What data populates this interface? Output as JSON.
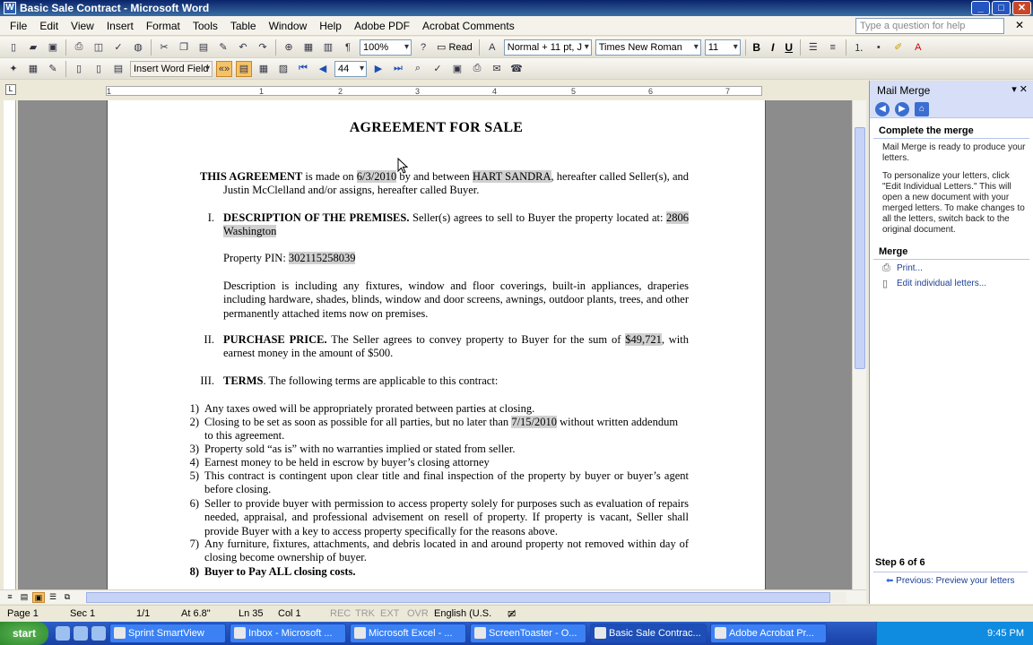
{
  "window": {
    "title": "Basic Sale Contract - Microsoft Word"
  },
  "menu": {
    "items": [
      "File",
      "Edit",
      "View",
      "Insert",
      "Format",
      "Tools",
      "Table",
      "Window",
      "Help",
      "Adobe PDF",
      "Acrobat Comments"
    ],
    "help_placeholder": "Type a question for help"
  },
  "toolbar": {
    "zoom": "100%",
    "read_label": "Read",
    "style": "Normal + 11 pt, J",
    "font": "Times New Roman",
    "size": "11"
  },
  "mailmerge_toolbar": {
    "insert_word_field": "Insert Word Field",
    "record": "44"
  },
  "document": {
    "title": "AGREEMENT FOR SALE",
    "intro_bold": "THIS AGREEMENT",
    "intro_text1": " is made on ",
    "date": "6/3/2010",
    "intro_text2": " by and between ",
    "seller": "HART SANDRA",
    "intro_text3": ", hereafter called Seller(s), and Justin McClelland and/or assigns, hereafter called Buyer.",
    "sec1_num": "I.",
    "sec1_head": "DESCRIPTION OF THE PREMISES.",
    "sec1_text": " Seller(s) agrees to sell to Buyer the property located at: ",
    "address": "2806 Washington",
    "pin_label": "Property PIN: ",
    "pin": "302115258039",
    "description": "Description is including any fixtures, window and floor coverings, built-in appliances, draperies including hardware, shades, blinds, window and door screens, awnings, outdoor plants, trees, and other permanently attached items now on premises.",
    "sec2_num": "II.",
    "sec2_head": "PURCHASE PRICE.",
    "sec2_text1": " The Seller agrees to convey property to Buyer for the sum of ",
    "price": "$49,721",
    "sec2_text2": ", with earnest money in the amount of $500.",
    "sec3_num": "III.",
    "sec3_head": "TERMS",
    "sec3_text": ". The following terms are applicable to this contract:",
    "terms": [
      {
        "num": "1)",
        "text": "Any taxes owed will be appropriately prorated between parties at closing."
      },
      {
        "num": "2)",
        "text_a": "Closing to be set as soon as possible for all parties, but no later than ",
        "date": "7/15/2010",
        "text_b": " without written addendum to this agreement."
      },
      {
        "num": "3)",
        "text": "Property sold “as is” with no warranties implied or stated from seller."
      },
      {
        "num": "4)",
        "text": "Earnest money to be held in escrow by buyer’s closing attorney"
      },
      {
        "num": "5)",
        "text": "This contract is contingent upon clear title and final inspection of the property by buyer or buyer’s agent before closing."
      },
      {
        "num": "6)",
        "text": "Seller to provide buyer with permission to access property solely for purposes such as evaluation of repairs needed, appraisal, and professional advisement on resell of property.  If property is vacant, Seller shall provide Buyer with a key to access property specifically for the reasons above."
      },
      {
        "num": "7)",
        "text": "Any furniture, fixtures, attachments, and debris located in and around property not removed within day of closing become ownership of buyer."
      },
      {
        "num": "8)",
        "text": "Buyer to Pay ALL closing costs."
      }
    ]
  },
  "taskpane": {
    "title": "Mail Merge",
    "section1": "Complete the merge",
    "text1": "Mail Merge is ready to produce your letters.",
    "text2": "To personalize your letters, click \"Edit Individual Letters.\" This will open a new document with your merged letters. To make changes to all the letters, switch back to the original document.",
    "section2": "Merge",
    "link_print": "Print...",
    "link_edit": "Edit individual letters...",
    "step": "Step 6 of 6",
    "previous": "Previous: Preview your letters"
  },
  "status": {
    "page": "Page 1",
    "sec": "Sec 1",
    "of": "1/1",
    "at": "At 6.8\"",
    "ln": "Ln 35",
    "col": "Col 1",
    "rec": "REC",
    "trk": "TRK",
    "ext": "EXT",
    "ovr": "OVR",
    "lang": "English (U.S."
  },
  "taskbar": {
    "start": "start",
    "tasks": [
      "Sprint SmartView",
      "Inbox - Microsoft ...",
      "Microsoft Excel - ...",
      "ScreenToaster - O...",
      "Basic Sale Contrac...",
      "Adobe Acrobat Pr..."
    ],
    "active_task": 4,
    "clock": "9:45 PM"
  },
  "ruler": {
    "ticks": [
      "1",
      "1",
      "2",
      "3",
      "4",
      "5",
      "6",
      "7"
    ]
  }
}
